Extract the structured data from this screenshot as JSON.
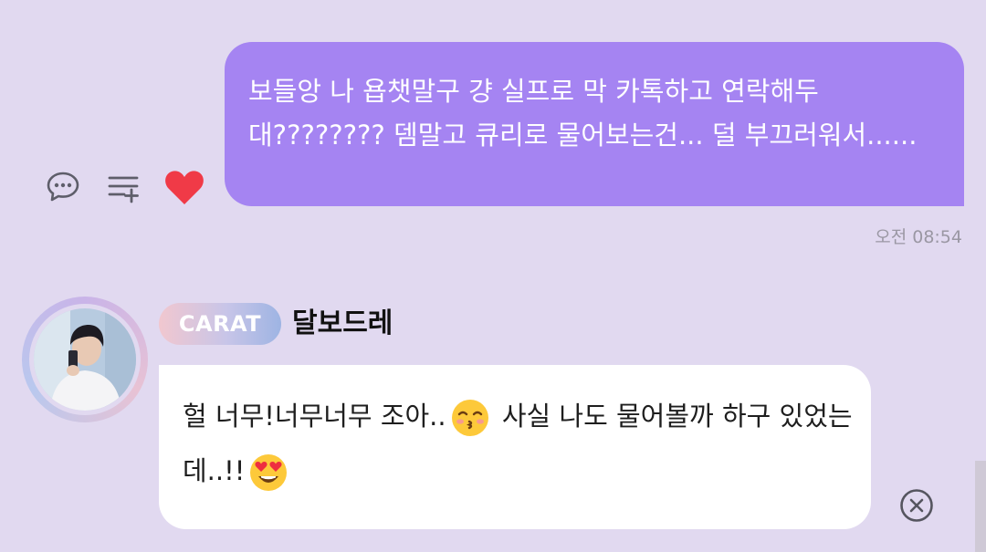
{
  "sent_message": {
    "line1": "보들앙 나 욥챗말구 걍 실프로 막 카톡하고 연락해두",
    "line2": "대???????? 뎀말고 큐리로 물어보는건... 덜 부끄러워서......",
    "time": "오전 08:54"
  },
  "actions": {
    "icons": [
      "chat-bubbles-icon",
      "add-to-list-icon",
      "heart-icon"
    ],
    "heart_color": "#f03a47"
  },
  "received_message": {
    "tag": "CARAT",
    "sender": "달보드레",
    "line1_a": "헐 너무!너무너무 조아..",
    "line1_b": "사실 나도 물어볼까 하구 있었는",
    "line2": "데..!!",
    "emojis": [
      "kissing-face-emoji",
      "heart-eyes-emoji"
    ]
  },
  "colors": {
    "background": "#e1d9f0",
    "sent_bubble": "#a584f2",
    "received_bubble": "#ffffff"
  }
}
